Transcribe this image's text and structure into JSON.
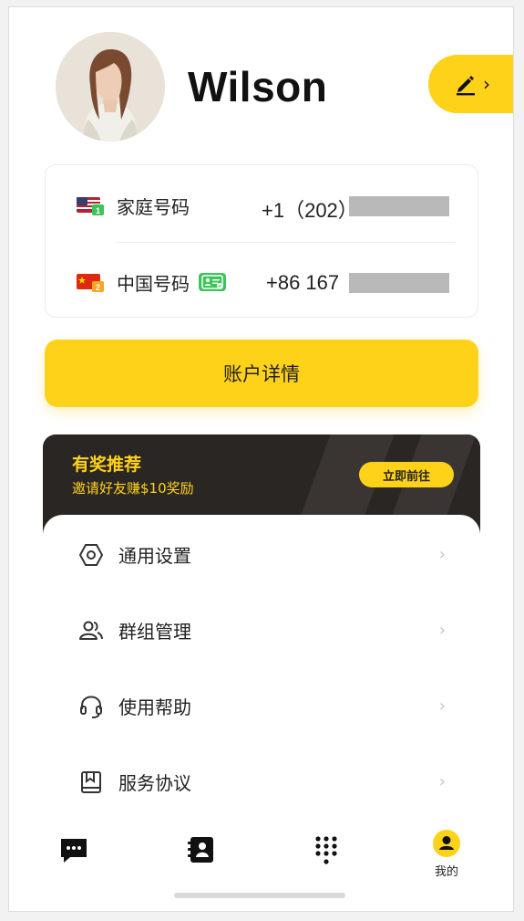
{
  "profile": {
    "name": "Wilson"
  },
  "phones": [
    {
      "label": "家庭号码",
      "value": "+1（202）",
      "flag": "us-flag-icon"
    },
    {
      "label": "中国号码",
      "value": "+86 167",
      "flag": "cn-flag-icon"
    }
  ],
  "account_button": "账户详情",
  "promo": {
    "title": "有奖推荐",
    "subtitle": "邀请好友赚$10奖励",
    "button": "立即前往"
  },
  "menu": [
    {
      "label": "通用设置",
      "icon": "hexagon-settings-icon"
    },
    {
      "label": "群组管理",
      "icon": "group-icon"
    },
    {
      "label": "使用帮助",
      "icon": "headset-icon"
    },
    {
      "label": "服务协议",
      "icon": "bookmark-icon"
    }
  ],
  "tabbar": {
    "me_label": "我的"
  },
  "colors": {
    "accent": "#ffd21a",
    "promo_bg": "#2a2624",
    "sim_badge": "#3cc45a"
  }
}
